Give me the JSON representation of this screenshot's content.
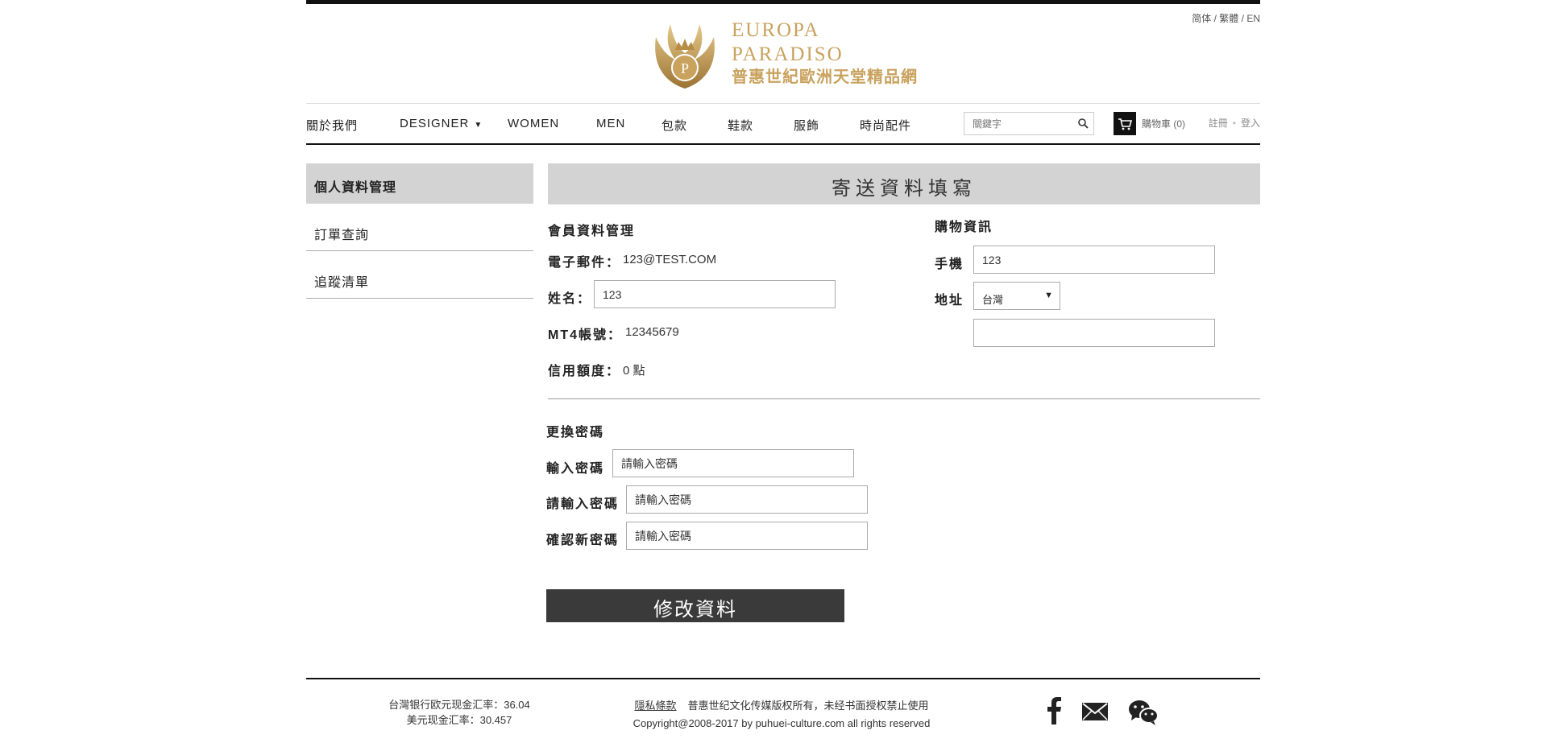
{
  "header": {
    "lang": {
      "simplified": "简体",
      "traditional": "繁體",
      "english": "EN",
      "sep": " / "
    },
    "logo": {
      "text_en": "EUROPA PARADISO",
      "text_zh": "普惠世紀歐洲天堂精品網",
      "color": "#c9a25e"
    }
  },
  "nav": {
    "items": [
      {
        "label": "關於我們"
      },
      {
        "label": "DESIGNER",
        "caret": "▼"
      },
      {
        "label": "WOMEN"
      },
      {
        "label": "MEN"
      },
      {
        "label": "包款"
      },
      {
        "label": "鞋款"
      },
      {
        "label": "服飾"
      },
      {
        "label": "時尚配件"
      }
    ],
    "search_placeholder": "關鍵字",
    "cart_label": "購物車 (0)",
    "register": "註冊",
    "login": "登入",
    "dot": "•"
  },
  "sidebar": {
    "title": "個人資料管理",
    "items": [
      {
        "label": "訂單查詢"
      },
      {
        "label": "追蹤清單"
      }
    ]
  },
  "main": {
    "title": "寄送資料填寫",
    "member": {
      "title": "會員資料管理",
      "email_label": "電子郵件：",
      "email_value": "123@TEST.COM",
      "name_label": "姓名：",
      "name_value": "123",
      "mt4_label": "MT4帳號：",
      "mt4_value": "12345679",
      "credit_label": "信用額度：",
      "credit_value": "0 點"
    },
    "shopping": {
      "title": "購物資訊",
      "phone_label": "手機",
      "phone_value": "123",
      "address_label": "地址",
      "country": "台灣",
      "address_value": ""
    },
    "password": {
      "title": "更換密碼",
      "input_label": "輸入密碼",
      "input_placeholder": "請輸入密碼",
      "reenter_label": "請輸入密碼",
      "reenter_placeholder": "請輸入密碼",
      "confirm_label": "確認新密碼",
      "confirm_placeholder": "請輸入密碼"
    },
    "submit_label": "修改資料"
  },
  "footer": {
    "rate_eur": "台灣银行欧元现金汇率：36.04",
    "rate_usd": "美元现金汇率：30.457",
    "privacy": "隱私條款",
    "rights": "普惠世纪文化传媒版权所有，未经书面授权禁止使用",
    "copyright": "Copyright@2008-2017 by puhuei-culture.com all rights reserved"
  }
}
